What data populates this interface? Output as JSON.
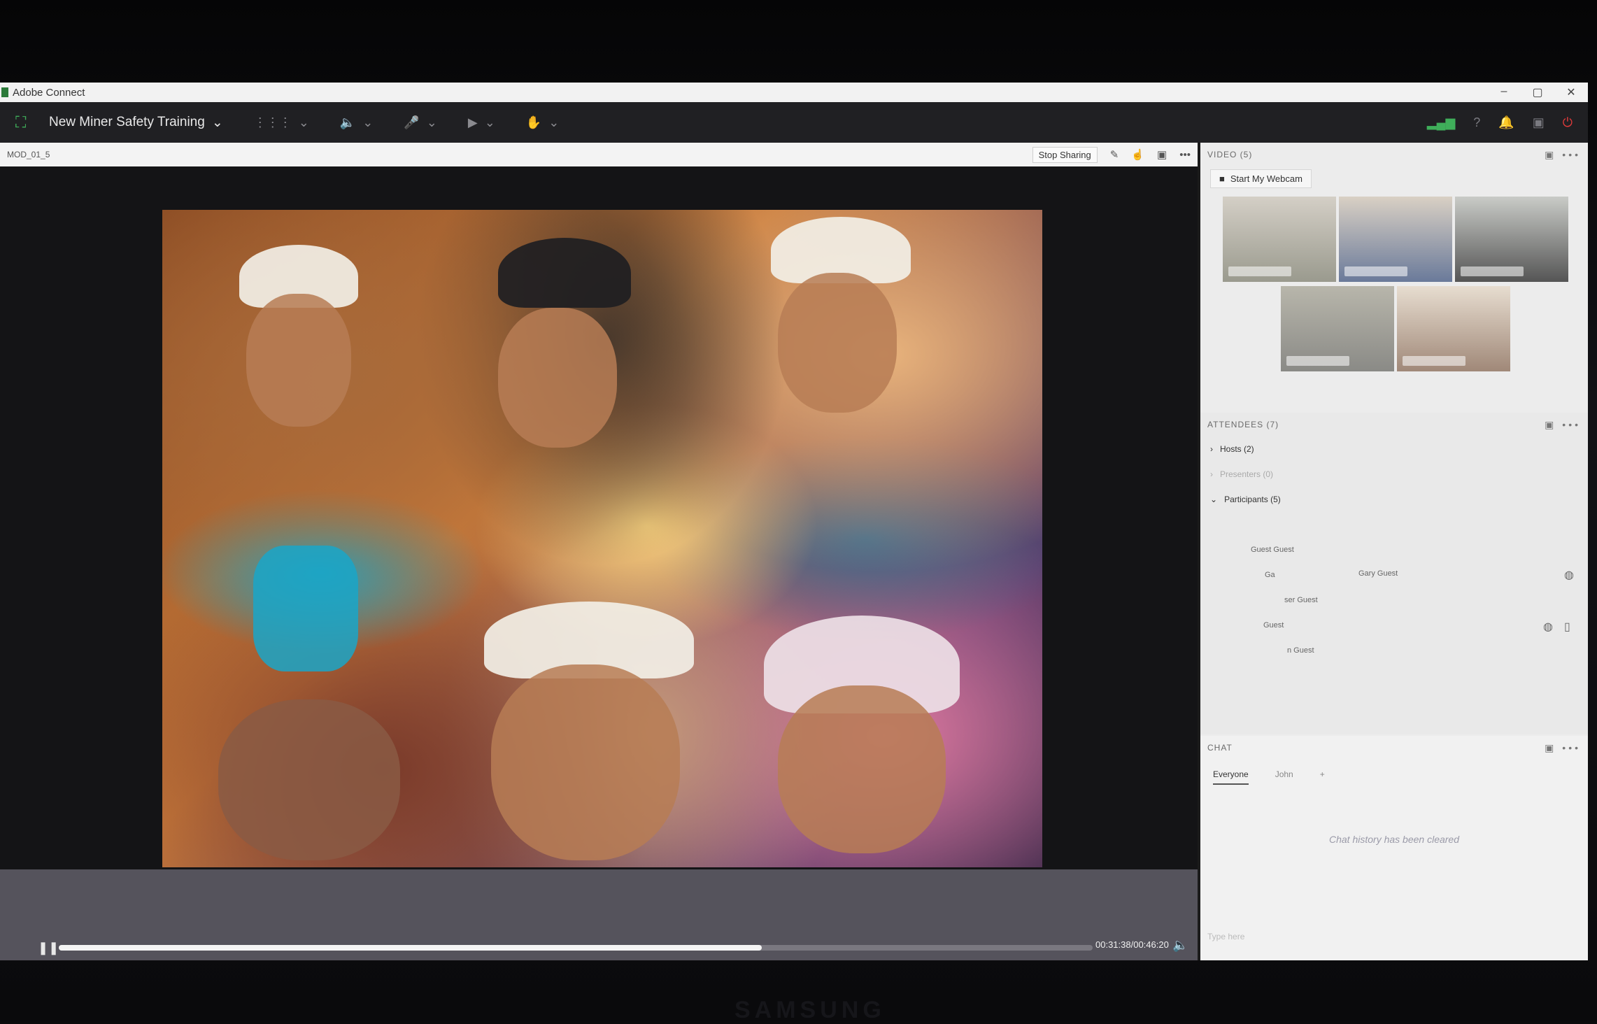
{
  "window": {
    "title": "Adobe Connect",
    "controls": [
      "–",
      "▢",
      "✕"
    ]
  },
  "menubar": {
    "meeting_name": "New Miner Safety Training",
    "icons": [
      "apps-icon",
      "speaker-icon",
      "microphone-icon",
      "camera-icon",
      "raise-hand-icon"
    ],
    "right_icons": [
      "connection-signal-icon",
      "help-icon",
      "notifications-icon",
      "fullscreen-icon",
      "end-meeting-icon"
    ],
    "accent_color": "#3fae5a",
    "end_color": "#e23b3b"
  },
  "share": {
    "pod_title": "MOD_01_5",
    "stop_label": "Stop Sharing",
    "timecode": "00:31:38/00:46:20",
    "progress": 0.68
  },
  "video_pod": {
    "title": "VIDEO (5)",
    "webcam_label": "Start My Webcam",
    "tiles": 5
  },
  "attendees": {
    "title": "ATTENDEES (7)",
    "hosts": "Hosts (2)",
    "presenters": "Presenters (0)",
    "participants": "Participants (5)",
    "names": [
      "Guest Guest",
      "Ga",
      "Gary Guest",
      "ser Guest",
      "Guest",
      "n Guest"
    ]
  },
  "chat": {
    "title": "CHAT",
    "tabs": [
      "Everyone",
      "John",
      "+"
    ],
    "empty_message": "Chat history has been cleared",
    "placeholder": "Type here"
  },
  "monitor": {
    "brand": "SAMSUNG"
  }
}
